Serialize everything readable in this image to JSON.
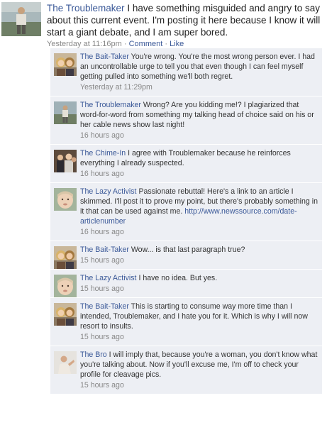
{
  "post": {
    "author": "The Troublemaker",
    "text": "I have something misguided and angry to say about this current event. I'm posting it here because I know it will start a giant debate, and I am super bored.",
    "time": "Yesterday at 11:16pm",
    "separator": "·",
    "comment_link": "Comment",
    "like_link": "Like"
  },
  "comments": [
    {
      "author": "The Bait-Taker",
      "text": "You're wrong. You're the most wrong person ever. I had an uncontrollable urge to tell you that even though I can feel myself getting pulled into something we'll both regret.",
      "time": "Yesterday at 11:29pm",
      "avatar": "two-women-photo"
    },
    {
      "author": "The Troublemaker",
      "text": "Wrong? Are you kidding me!? I plagiarized that word-for-word from something my talking head of choice said on his or her cable news show last night!",
      "time": "16 hours ago",
      "avatar": "man-standing-photo"
    },
    {
      "author": "The Chime-In",
      "text": "I agree with Troublemaker because he reinforces everything I already suspected.",
      "time": "16 hours ago",
      "avatar": "group-photo"
    },
    {
      "author": "The Lazy Activist",
      "text": "Passionate rebuttal! Here's a link to an article I skimmed. I'll post it to prove my point, but there's probably something in it that can be used against me.",
      "url": "http://www.newssource.com/date-articlenumber",
      "time": "16 hours ago",
      "avatar": "baby-photo"
    },
    {
      "author": "The Bait-Taker",
      "text": "Wow... is that last paragraph true?",
      "time": "15 hours ago",
      "avatar": "two-women-photo"
    },
    {
      "author": "The Lazy Activist",
      "text": "I have no idea. But yes.",
      "time": "15 hours ago",
      "avatar": "baby-photo"
    },
    {
      "author": "The Bait-Taker",
      "text": "This is starting to consume way more time than I intended, Troublemaker, and I hate you for it. Which is why I will now resort to insults.",
      "time": "15 hours ago",
      "avatar": "two-women-photo"
    },
    {
      "author": "The Bro",
      "text": "I will imply that, because you're a woman, you don't know what you're talking about. Now if you'll excuse me, I'm off to check your profile for cleavage pics.",
      "time": "15 hours ago",
      "avatar": "man-posing-photo"
    }
  ]
}
